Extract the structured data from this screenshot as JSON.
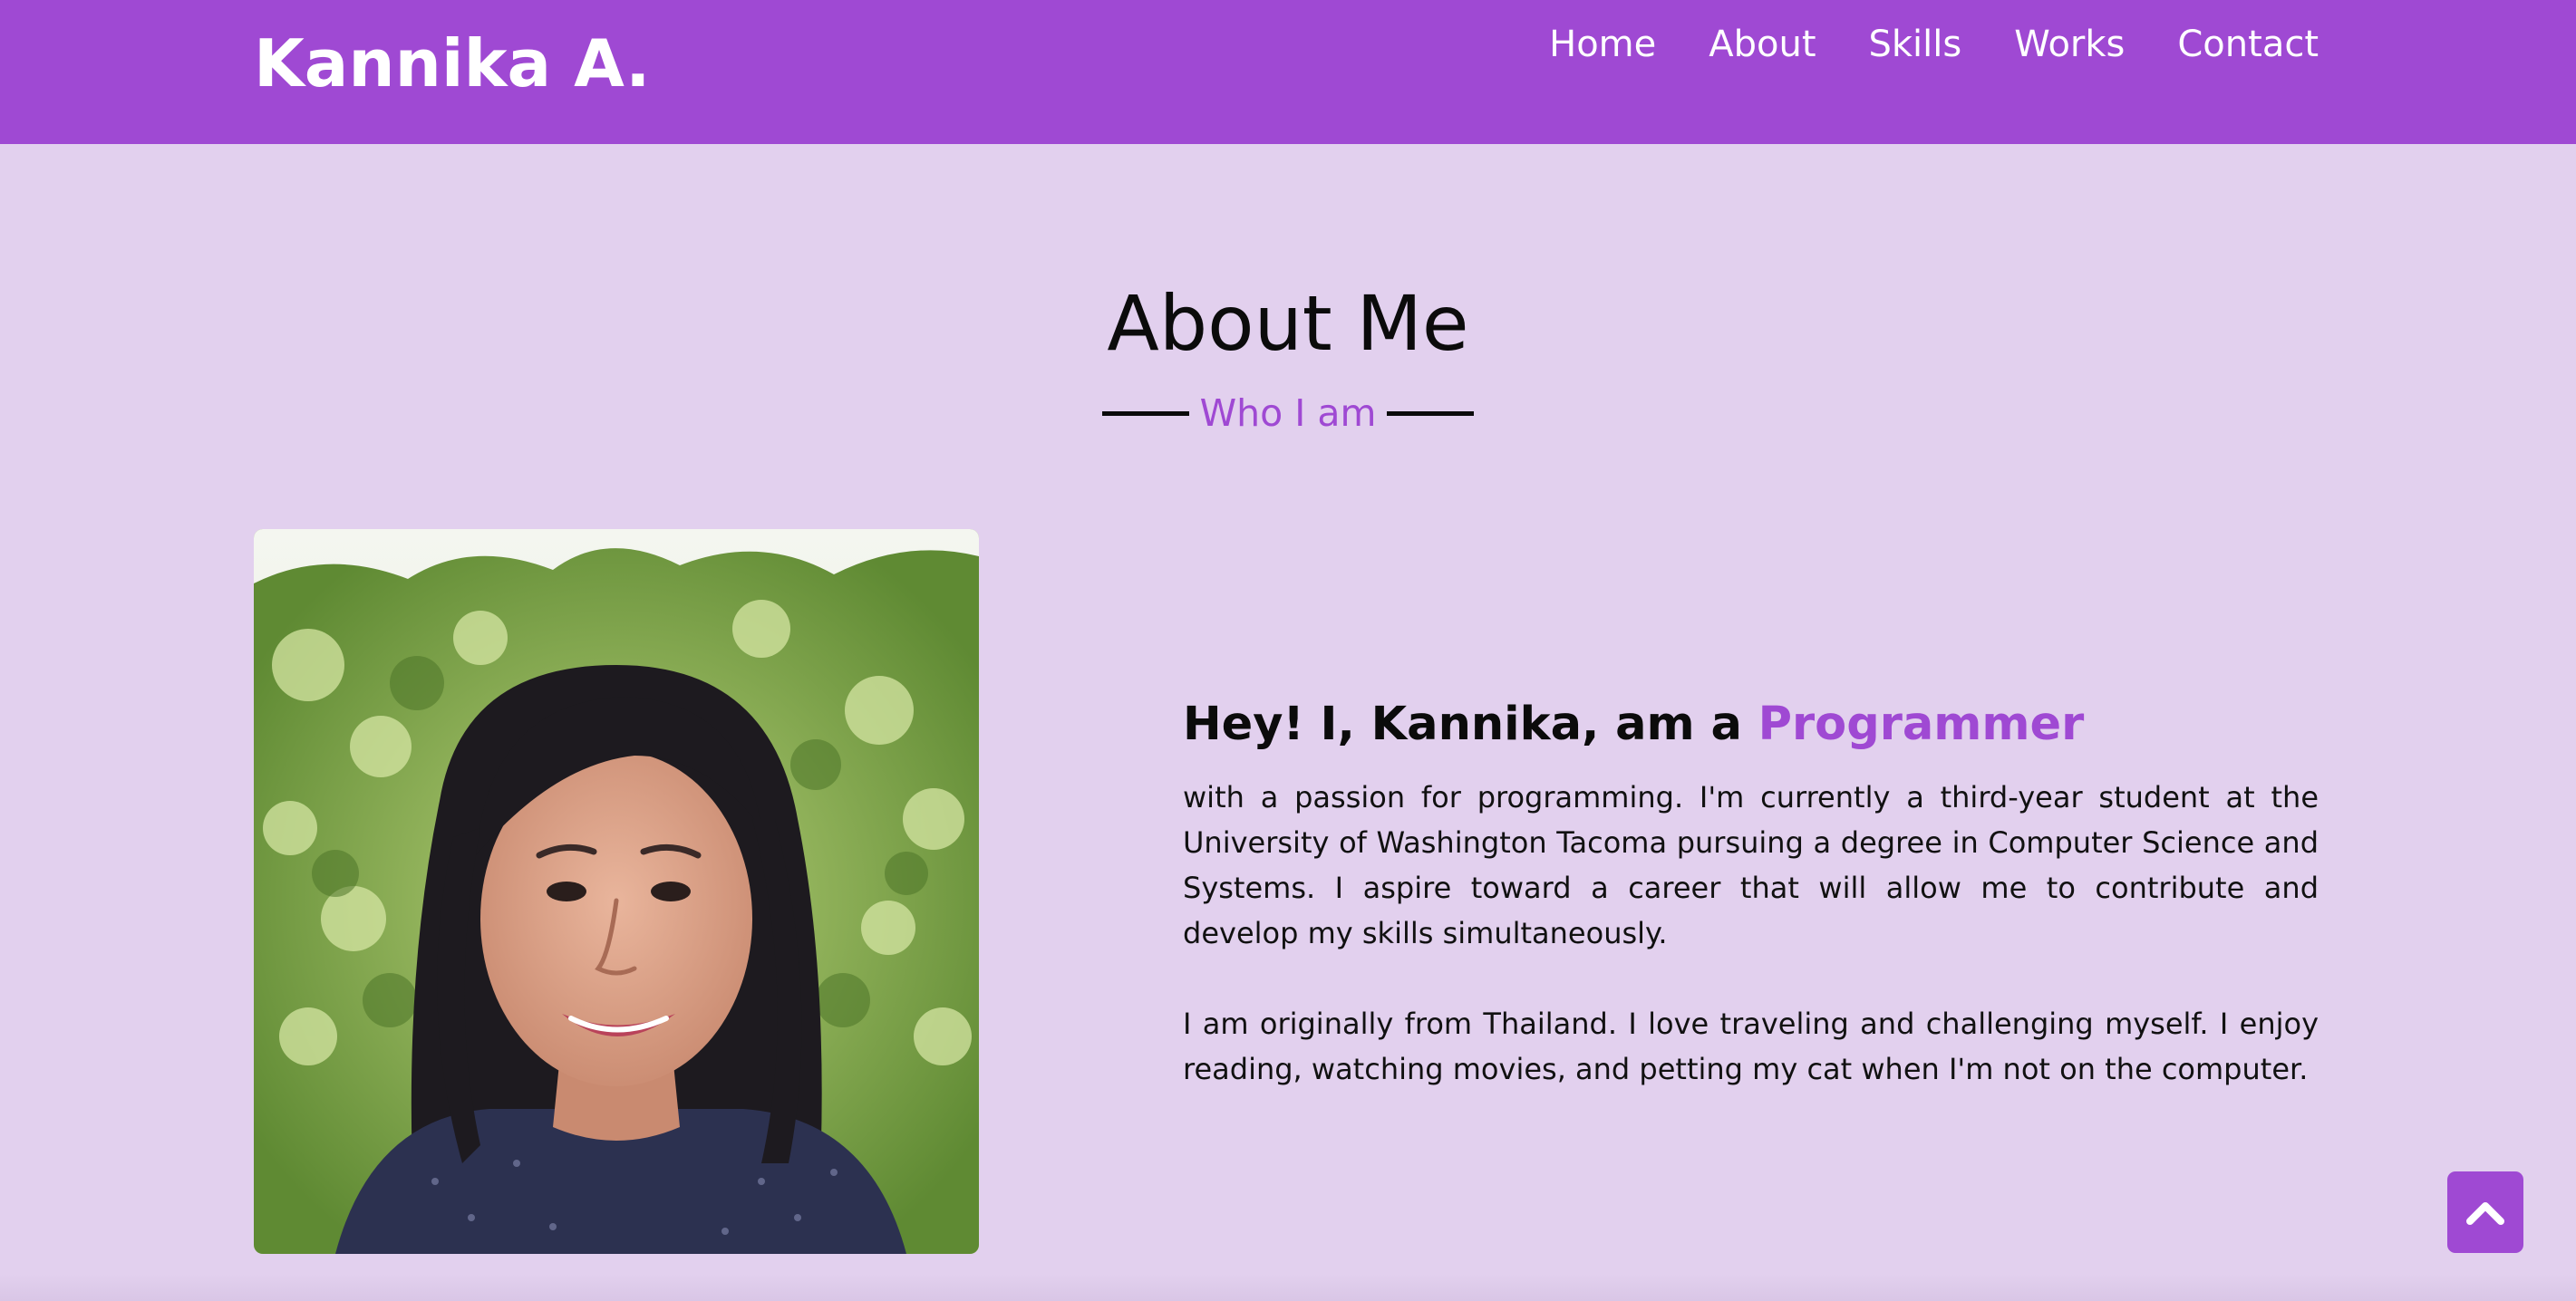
{
  "navbar": {
    "brand": "Kannika A.",
    "links": [
      "Home",
      "About",
      "Skills",
      "Works",
      "Contact"
    ]
  },
  "about": {
    "title": "About Me",
    "subtitle": "Who I am",
    "greeting_prefix": "Hey! I, Kannika, am a ",
    "greeting_role": "Programmer",
    "paragraphs": [
      "with a passion for programming. I'm currently a third-year student at the University of Washington Tacoma pursuing a degree in Computer Science and Systems. I aspire toward a career that will allow me to contribute and develop my skills simultaneously.",
      "I am originally from Thailand. I love traveling and challenging myself. I enjoy reading, watching movies, and petting my cat when I'm not on the computer."
    ]
  },
  "scroll_up": {
    "icon": "chevron-up-icon"
  },
  "colors": {
    "accent": "#9f49d3",
    "background": "#e2d0ee",
    "text": "#0b0b0b",
    "nav_text": "#ffffff"
  }
}
